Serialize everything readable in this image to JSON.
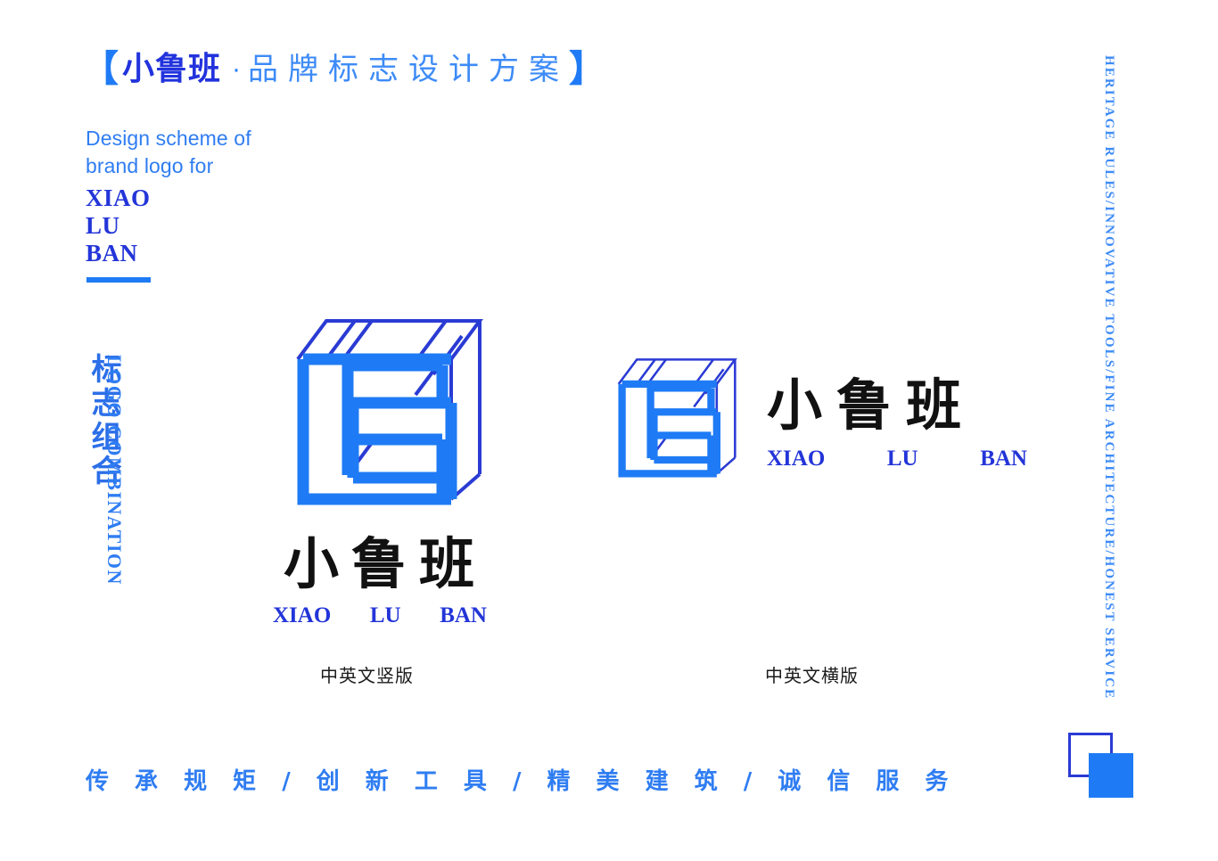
{
  "header": {
    "bracket_open": "【",
    "brand_cn": "小鲁班",
    "separator_dot": "·",
    "title_rest": "品牌标志设计方案",
    "bracket_close": "】"
  },
  "subtitle": {
    "line1": "Design scheme of",
    "line2": "brand logo for",
    "name_line1": "XIAO",
    "name_line2": "LU",
    "name_line3": "BAN"
  },
  "side_labels": {
    "left_cn": "标志组合",
    "left_en": "LOGO COMBINATION",
    "right_en": "HERITAGE RULES/INNOVATIVE TOOLS/FINE ARCHITECTURE/HONEST SERVICE"
  },
  "lockups": {
    "vertical": {
      "wordmark_cn": "小鲁班",
      "pinyin_1": "XIAO",
      "pinyin_2": "LU",
      "pinyin_3": "BAN",
      "caption": "中英文竖版"
    },
    "horizontal": {
      "wordmark_cn": "小鲁班",
      "pinyin_1": "XIAO",
      "pinyin_2": "LU",
      "pinyin_3": "BAN",
      "caption": "中英文横版"
    }
  },
  "footer": {
    "tagline": "传 承 规 矩 / 创 新 工 具 / 精 美 建 筑 / 诚 信 服 务"
  },
  "colors": {
    "bright_blue": "#1f7bf5",
    "deep_blue": "#2335d8",
    "mid_blue": "#3d8bf7",
    "ink": "#111111",
    "background": "#ffffff"
  }
}
